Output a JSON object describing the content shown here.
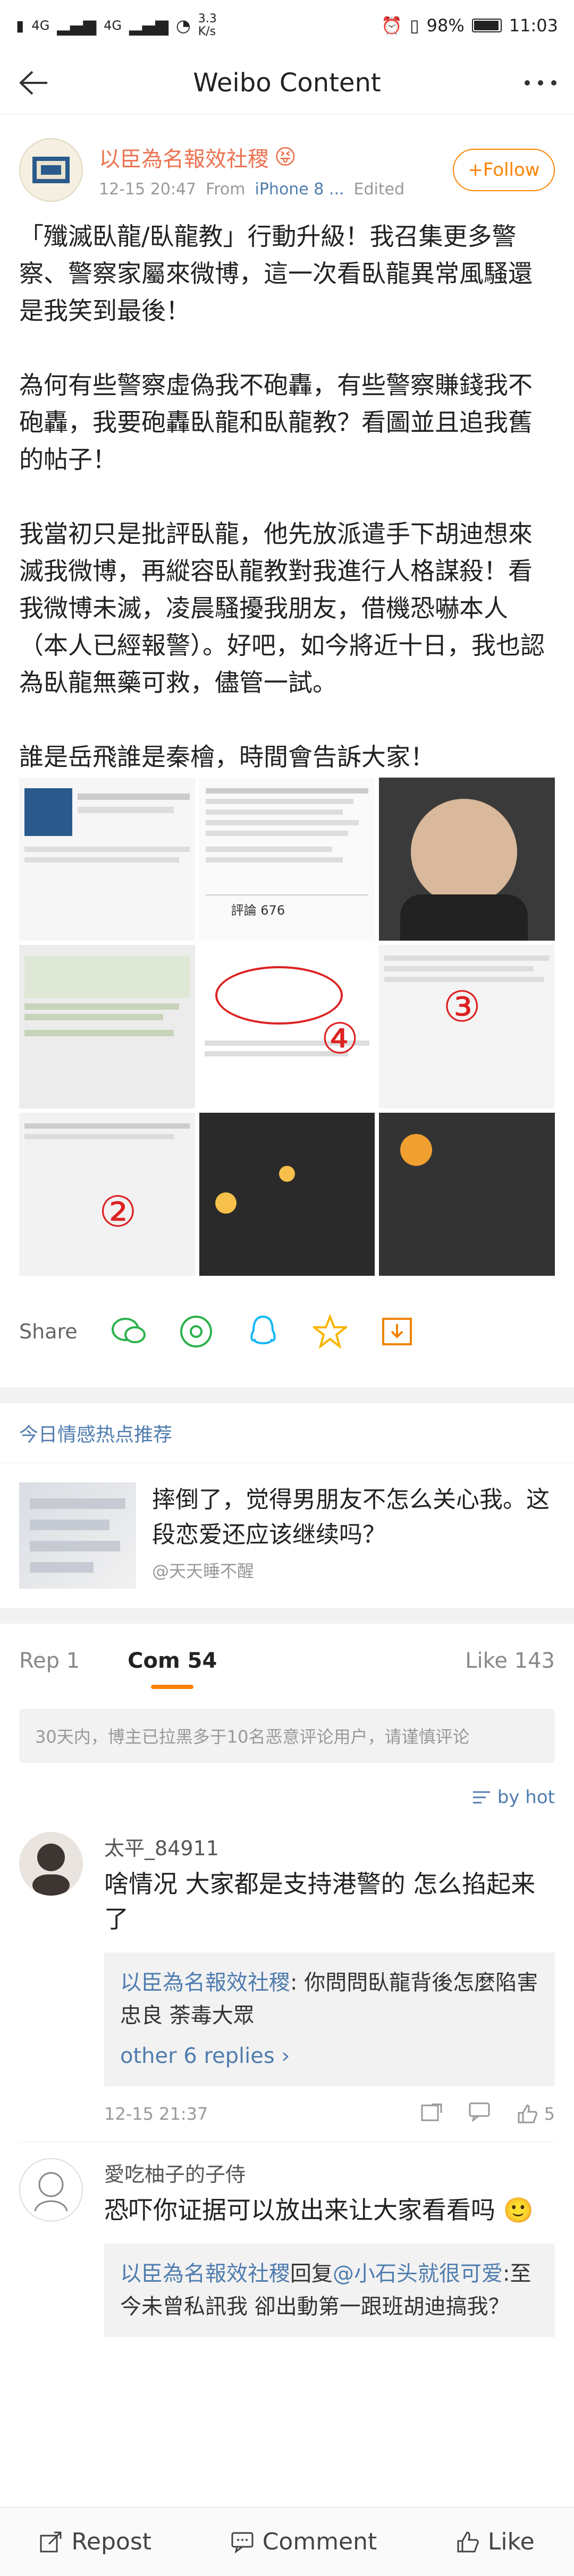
{
  "status_bar": {
    "network": "4G",
    "network2": "4G",
    "speed": "3.3 K/s",
    "battery": "98%",
    "time": "11:03"
  },
  "nav": {
    "title": "Weibo Content"
  },
  "post": {
    "author": "以臣為名報效社稷",
    "emoji": "😝",
    "timestamp": "12-15 20:47",
    "source_prefix": "From",
    "source": "iPhone 8 ...",
    "edited": "Edited",
    "follow_label": "+Follow",
    "paragraphs": [
      "「殲滅臥龍/臥龍教」行動升級！我召集更多警察、警察家屬來微博，這一次看臥龍異常風騷還是我笑到最後！",
      "為何有些警察虛偽我不砲轟，有些警察賺錢我不砲轟，我要砲轟臥龍和臥龍教？看圖並且追我舊的帖子！",
      "我當初只是批評臥龍，他先放派遣手下胡迪想來滅我微博，再縱容臥龍教對我進行人格謀殺！看我微博未滅，凌晨騷擾我朋友，借機恐嚇本人（本人已經報警）。好吧，如今將近十日，我也認為臥龍無藥可救，儘管一試。",
      "誰是岳飛誰是秦檜，時間會告訴大家！"
    ],
    "image_labels": [
      "評論 676",
      "②",
      "③",
      "④"
    ]
  },
  "share": {
    "label": "Share"
  },
  "recommend": {
    "title": "今日情感热点推荐",
    "text": "摔倒了，觉得男朋友不怎么关心我。这段恋爱还应该继续吗？",
    "source": "@天天睡不醒"
  },
  "tabs": {
    "repost": "Rep 1",
    "comments": "Com 54",
    "likes": "Like 143"
  },
  "notice": "30天内，博主已拉黑多于10名恶意评论用户，请谨慎评论",
  "sort": {
    "label": "by hot"
  },
  "comments": [
    {
      "name": "太平_84911",
      "text": "啥情况 大家都是支持港警的 怎么掐起来了",
      "reply_name": "以臣為名報效社稷",
      "reply_text": ": 你問問臥龍背後怎麼陷害忠良 荼毒大眾",
      "more": "other 6 replies ›",
      "time": "12-15 21:37",
      "likes": "5"
    },
    {
      "name": "愛吃柚子的子侍",
      "text": "恐吓你证据可以放出来让大家看看吗",
      "emoji": "🙂",
      "reply_name": "以臣為名報效社稷",
      "reply_mid": "回复",
      "reply_mention": "@小石头就很可爱",
      "reply_text": ":至今未曾私訊我 卻出動第一跟班胡迪搞我？"
    }
  ],
  "bottom_bar": {
    "repost": "Repost",
    "comment": "Comment",
    "like": "Like"
  }
}
